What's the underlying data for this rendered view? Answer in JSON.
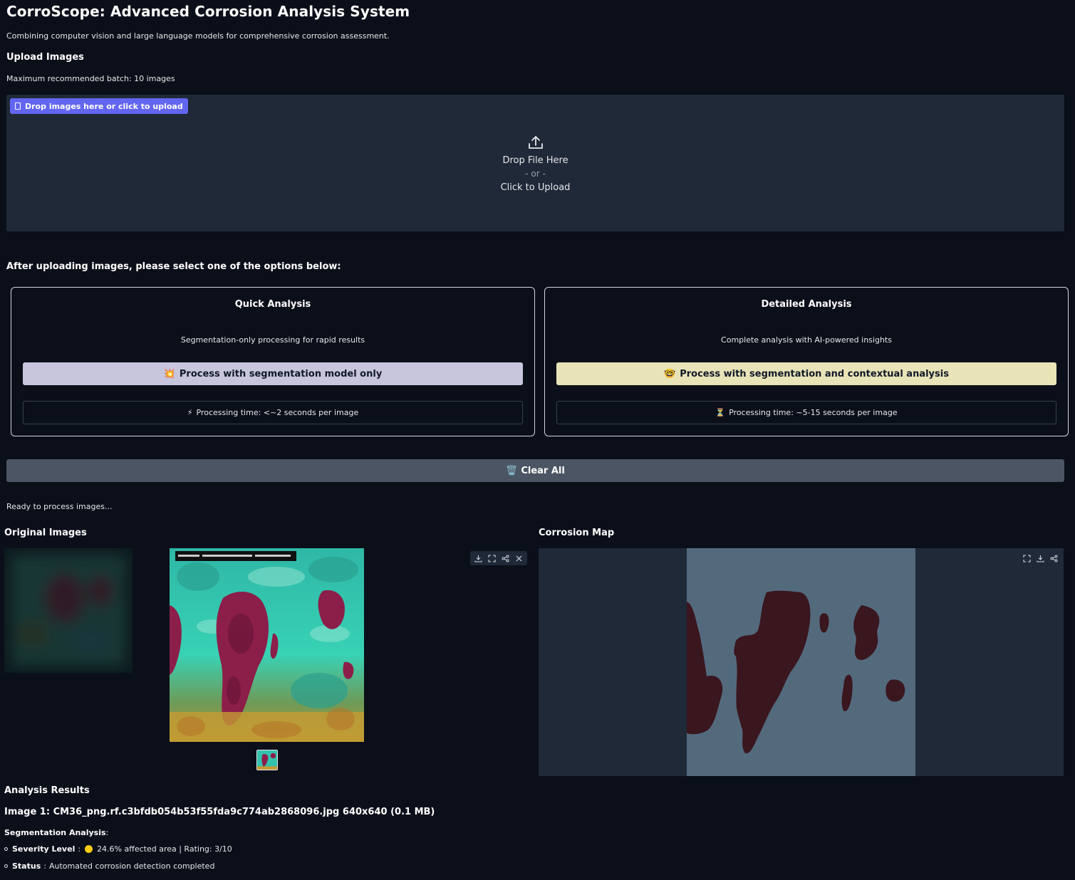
{
  "header": {
    "title": "CorroScope: Advanced Corrosion Analysis System",
    "subtitle": "Combining computer vision and large language models for comprehensive corrosion assessment."
  },
  "upload": {
    "heading": "Upload Images",
    "batch_note": "Maximum recommended batch: 10 images",
    "badge_label": "Drop images here or click to upload",
    "drop_text": "Drop File Here",
    "or_text": "- or -",
    "click_text": "Click to Upload"
  },
  "options": {
    "prompt": "After uploading images, please select one of the options below:",
    "quick": {
      "title": "Quick Analysis",
      "description": "Segmentation-only processing for rapid results",
      "button_icon": "💥",
      "button_label": "Process with segmentation model only",
      "time_icon": "⚡",
      "time_label": "Processing time: <~2 seconds per image"
    },
    "detailed": {
      "title": "Detailed Analysis",
      "description": "Complete analysis with AI-powered insights",
      "button_icon": "🤓",
      "button_label": "Process with segmentation and contextual analysis",
      "time_icon": "⏳",
      "time_label": "Processing time: ~5-15 seconds per image"
    }
  },
  "clear_button": {
    "icon": "🗑️",
    "label": "Clear All"
  },
  "status": {
    "text": "Ready to process images..."
  },
  "gallery": {
    "label": "Original Images",
    "toolbar_icons": [
      "download-icon",
      "fullscreen-icon",
      "share-icon",
      "close-icon"
    ]
  },
  "corrosion_map": {
    "label": "Corrosion Map",
    "toolbar_icons": [
      "fullscreen-icon",
      "download-icon",
      "share-icon"
    ]
  },
  "results": {
    "heading": "Analysis Results",
    "image_line": "Image 1: CM36_png.rf.c3bfdb054b53f55fda9c774ab2868096.jpg 640x640 (0.1 MB)",
    "segmentation_label": "Segmentation Analysis",
    "severity_label": "Severity Level",
    "severity_value": "24.6% affected area | Rating: 3/10",
    "severity_color": "#facc15",
    "status_label": "Status",
    "status_value": "Automated corrosion detection completed"
  },
  "colors": {
    "background": "#0b0f19",
    "panel": "#1f2937",
    "accent": "#6366f1",
    "quick_button": "#c7c6dc",
    "detailed_button": "#e8e4b8",
    "clear_button": "#4b5563",
    "map_background": "#536a7d",
    "map_corrosion": "#3a161e"
  }
}
